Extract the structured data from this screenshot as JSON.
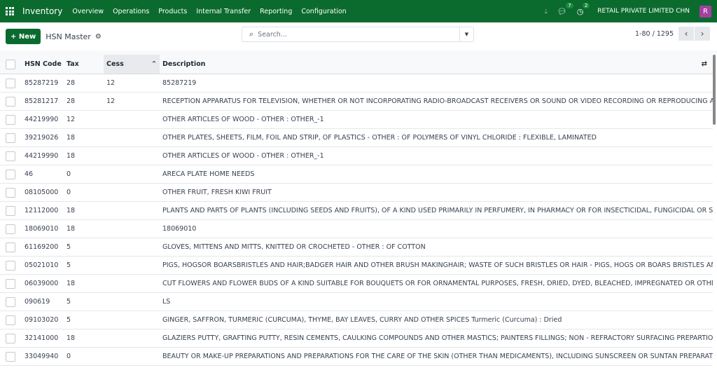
{
  "nav": {
    "app": "Inventory",
    "menus": [
      "Overview",
      "Operations",
      "Products",
      "Internal Transfer",
      "Reporting",
      "Configuration"
    ],
    "messages_count": "7",
    "activities_count": "2",
    "company": "RETAIL PRIVATE LIMITED CHN",
    "avatar": "R"
  },
  "control": {
    "new_label": "New",
    "title": "HSN Master",
    "search_placeholder": "Search...",
    "pager": "1-80 / 1295"
  },
  "table": {
    "headers": [
      "HSN Code",
      "Tax",
      "Cess",
      "Description"
    ],
    "rows": [
      [
        "85287219",
        "28",
        "12",
        "85287219"
      ],
      [
        "85281217",
        "28",
        "12",
        "RECEPTION APPARATUS FOR TELEVISION, WHETHER OR NOT INCORPORATING RADIO-BROADCAST RECEIVERS OR SOUND OR VIDEO RECORDING OR REPRODUCING APPAR..."
      ],
      [
        "44219990",
        "12",
        "",
        "OTHER ARTICLES OF WOOD - OTHER : OTHER_-1"
      ],
      [
        "39219026",
        "18",
        "",
        "OTHER PLATES, SHEETS, FILM, FOIL AND STRIP, OF PLASTICS - OTHER : OF POLYMERS OF VINYL CHLORIDE : FLEXIBLE, LAMINATED"
      ],
      [
        "44219990",
        "18",
        "",
        "OTHER ARTICLES OF WOOD - OTHER : OTHER_-1"
      ],
      [
        "46",
        "0",
        "",
        "ARECA PLATE HOME NEEDS"
      ],
      [
        "08105000",
        "0",
        "",
        "OTHER FRUIT, FRESH KIWI FRUIT"
      ],
      [
        "12112000",
        "18",
        "",
        "PLANTS AND PARTS OF PLANTS (INCLUDING SEEDS AND FRUITS), OF A KIND USED PRIMARILY IN PERFUMERY, IN PHARMACY OR FOR INSECTICIDAL, FUNGICIDAL OR SIMILAR ..."
      ],
      [
        "18069010",
        "18",
        "",
        "18069010"
      ],
      [
        "61169200",
        "5",
        "",
        "GLOVES, MITTENS AND MITTS, KNITTED OR CROCHETED - OTHER : OF COTTON"
      ],
      [
        "05021010",
        "5",
        "",
        "PIGS, HOGSOR BOARSBRISTLES AND HAIR;BADGER HAIR AND OTHER BRUSH MAKINGHAIR; WASTE OF SUCH BRISTLES OR HAIR - PIGS, HOGS OR BOARS BRISTLES AND HAIR A..."
      ],
      [
        "06039000",
        "18",
        "",
        "CUT FLOWERS AND FLOWER BUDS OF A KIND SUITABLE FOR BOUQUETS OR FOR ORNAMENTAL PURPOSES, FRESH, DRIED, DYED, BLEACHED, IMPREGNATED OR OTHERWISE ..."
      ],
      [
        "090619",
        "5",
        "",
        "LS"
      ],
      [
        "09103020",
        "5",
        "",
        "GINGER, SAFFRON, TURMERIC (CURCUMA), THYME, BAY LEAVES, CURRY AND OTHER SPICES Turmeric (Curcuma) : Dried"
      ],
      [
        "32141000",
        "18",
        "",
        "GLAZIERS PUTTY, GRAFTING PUTTY, RESIN CEMENTS, CAULKING COMPOUNDS AND OTHER MASTICS; PAINTERS FILLINGS; NON - REFRACTORY SURFACING PREPARTIONS FOR..."
      ],
      [
        "33049940",
        "0",
        "",
        "BEAUTY OR MAKE-UP PREPARATIONS AND PREPARATIONS FOR THE CARE OF THE SKIN (OTHER THAN MEDICAMENTS), INCLUDING SUNSCREEN OR SUNTAN PREPARATIONS; ..."
      ]
    ]
  }
}
